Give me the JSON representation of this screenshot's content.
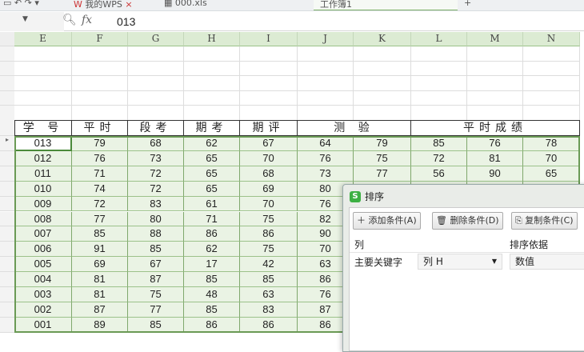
{
  "tabs": [
    {
      "label": "我的WPS"
    },
    {
      "label": "000.xls"
    },
    {
      "label": "工作簿1"
    }
  ],
  "formula_bar": {
    "fx": "fx",
    "value": "013"
  },
  "columns": [
    "E",
    "F",
    "G",
    "H",
    "I",
    "J",
    "K",
    "L",
    "M",
    "N"
  ],
  "header_row": {
    "id": "学 号",
    "c1": "平时",
    "c2": "段考",
    "c3": "期考",
    "c4": "期评",
    "c5": "测 验",
    "c6": "平时成绩"
  },
  "rows": [
    [
      "013",
      "79",
      "68",
      "62",
      "67",
      "64",
      "79",
      "85",
      "76",
      "78"
    ],
    [
      "012",
      "76",
      "73",
      "65",
      "70",
      "76",
      "75",
      "72",
      "81",
      "70"
    ],
    [
      "011",
      "71",
      "72",
      "65",
      "68",
      "73",
      "77",
      "56",
      "90",
      "65"
    ],
    [
      "010",
      "74",
      "72",
      "65",
      "69",
      "80",
      "",
      "",
      "",
      ""
    ],
    [
      "009",
      "72",
      "83",
      "61",
      "70",
      "76",
      "",
      "",
      "",
      ""
    ],
    [
      "008",
      "77",
      "80",
      "71",
      "75",
      "82",
      "",
      "",
      "",
      ""
    ],
    [
      "007",
      "85",
      "88",
      "86",
      "86",
      "90",
      "",
      "",
      "",
      ""
    ],
    [
      "006",
      "91",
      "85",
      "62",
      "75",
      "70",
      "",
      "",
      "",
      ""
    ],
    [
      "005",
      "69",
      "67",
      "17",
      "42",
      "63",
      "",
      "",
      "",
      ""
    ],
    [
      "004",
      "81",
      "87",
      "85",
      "85",
      "86",
      "",
      "",
      "",
      ""
    ],
    [
      "003",
      "81",
      "75",
      "48",
      "63",
      "76",
      "",
      "",
      "",
      ""
    ],
    [
      "002",
      "87",
      "77",
      "85",
      "83",
      "87",
      "",
      "",
      "",
      ""
    ],
    [
      "001",
      "89",
      "85",
      "86",
      "86",
      "86",
      "",
      "",
      "",
      ""
    ]
  ],
  "dialog": {
    "title": "排序",
    "logo": "S",
    "add": "添加条件(A)",
    "delete": "删除条件(D)",
    "copy": "复制条件(C)",
    "col_header": "列",
    "basis_header": "排序依据",
    "key_label": "主要关键字",
    "key_value": "列 H",
    "basis_value": "数值"
  },
  "colors": {
    "accent": "#3cb043",
    "annotation": "#c0312f"
  }
}
